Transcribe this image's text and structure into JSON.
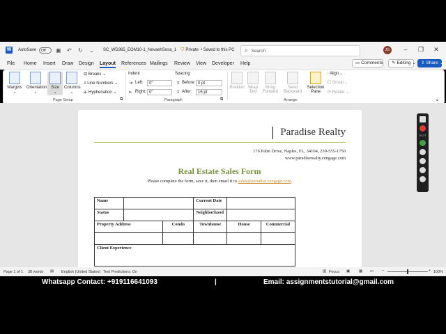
{
  "titlebar": {
    "app_icon": "word-icon",
    "autosave_label": "AutoSave",
    "autosave_state": "Off",
    "filename": "SC_WD365_EOM10-1_NevaehSosa_1",
    "privacy": "Private",
    "save_state": "• Saved to this PC",
    "search_placeholder": "Search",
    "avatar_initials": "JG"
  },
  "menu": {
    "items": [
      "File",
      "Home",
      "Insert",
      "Draw",
      "Design",
      "Layout",
      "References",
      "Mailings",
      "Review",
      "View",
      "Developer",
      "Help"
    ],
    "active": "Layout",
    "comments_label": "Comments",
    "editing_label": "Editing",
    "share_label": "Share"
  },
  "ribbon": {
    "page_setup": {
      "label": "Page Setup",
      "margins": "Margins",
      "orientation": "Orientation",
      "size": "Size",
      "columns": "Columns",
      "breaks": "Breaks",
      "line_numbers": "Line Numbers",
      "hyphenation": "Hyphenation"
    },
    "paragraph": {
      "label": "Paragraph",
      "indent_title": "Indent",
      "spacing_title": "Spacing",
      "left_label": "Left:",
      "left_value": "0\"",
      "right_label": "Right:",
      "right_value": "0\"",
      "before_label": "Before:",
      "before_value": "0 pt",
      "after_label": "After:",
      "after_value": "15 pt"
    },
    "arrange": {
      "label": "Arrange",
      "position": "Position",
      "wrap_text": "Wrap Text",
      "bring_forward": "Bring Forward",
      "send_backward": "Send Backward",
      "selection_pane": "Selection Pane",
      "align": "Align",
      "group": "Group",
      "rotate": "Rotate"
    }
  },
  "document": {
    "company": "Paradise Realty",
    "address": "176 Palm Drive, Naples, FL, 34104, 239-555-1750",
    "website": "www.paradiserealty.cengage.com",
    "form_title": "Real Estate Sales Form",
    "instructions_prefix": "Please complete the form, save it, then email it to ",
    "email_link": "sales@paradise.cengage.com",
    "instructions_suffix": ".",
    "table": {
      "name": "Name",
      "current_date": "Current Date",
      "status": "Status",
      "neighborhood": "Neighborhood",
      "property_address": "Property Address",
      "condo": "Condo",
      "townhouse": "Townhouse",
      "house": "House",
      "commercial": "Commercial",
      "client_experience": "Client Experience"
    }
  },
  "statusbar": {
    "page": "Page 1 of 1",
    "words": "38 words",
    "language": "English (United States)",
    "predictions": "Text Predictions: On",
    "focus": "Focus",
    "zoom": "100%"
  },
  "recorder": {
    "timer": "01:37"
  },
  "footer": {
    "whatsapp": "Whatsapp Contact: +919116641093",
    "separator": "|",
    "email": "Email: assignmentstutorial@gmail.com"
  },
  "colors": {
    "accent": "#185abd",
    "title_green": "#76923c",
    "link_orange": "#c0504d"
  }
}
